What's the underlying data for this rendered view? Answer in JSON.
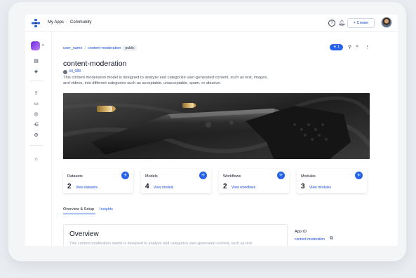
{
  "topbar": {
    "nav": [
      "My Apps",
      "Community"
    ],
    "create_label": "+ Create"
  },
  "breadcrumb": {
    "user": "user_name",
    "app": "content-moderation",
    "visibility": "public"
  },
  "actions": {
    "star_count": "★ 1"
  },
  "app": {
    "title": "content-moderation",
    "owner": "kll_088",
    "description": "This content moderation model is designed to analyze and categorize user-generated content, such as text, images, and videos, into different categories such as acceptable, unacceptable, spam, or abusive."
  },
  "cards": [
    {
      "title": "Datasets",
      "count": "2",
      "link": "View datasets"
    },
    {
      "title": "Models",
      "count": "4",
      "link": "View models"
    },
    {
      "title": "Workflows",
      "count": "2",
      "link": "View workflows"
    },
    {
      "title": "Modules",
      "count": "3",
      "link": "View modules"
    }
  ],
  "tabs": [
    "Overview & Setup",
    "Insights"
  ],
  "overview": {
    "title": "Overview",
    "text": "This content moderation model is designed to analyze and categorize user-generated content, such as text"
  },
  "app_id": {
    "label": "App ID",
    "value": "content-moderation"
  },
  "colors": {
    "accent": "#2563eb",
    "link": "#1d4ed8"
  },
  "icons": [
    "logo-icon",
    "help-icon",
    "bell-icon",
    "avatar",
    "share-icon",
    "more-icon",
    "pin-icon",
    "copy-icon",
    "tag-icon"
  ]
}
